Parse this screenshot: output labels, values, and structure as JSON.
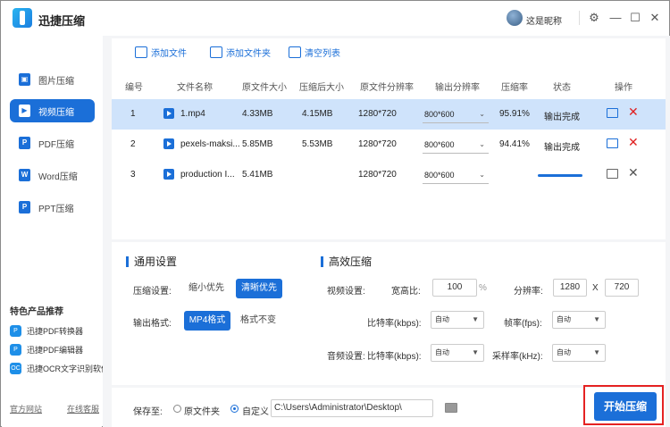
{
  "app": {
    "title": "迅捷压缩",
    "username": "这是昵称"
  },
  "window_controls": {
    "settings": "⚙",
    "minimize": "—",
    "maximize": "☐",
    "close": "✕"
  },
  "sidebar": {
    "items": [
      {
        "label": "图片压缩",
        "icon": "image-icon"
      },
      {
        "label": "视频压缩",
        "icon": "video-icon",
        "active": true
      },
      {
        "label": "PDF压缩",
        "icon": "pdf-icon"
      },
      {
        "label": "Word压缩",
        "icon": "word-icon"
      },
      {
        "label": "PPT压缩",
        "icon": "ppt-icon"
      }
    ],
    "featured_title": "特色产品推荐",
    "featured": [
      {
        "label": "迅捷PDF转换器"
      },
      {
        "label": "迅捷PDF编辑器"
      },
      {
        "label": "迅捷OCR文字识别软件"
      }
    ],
    "official_site": "官方网站",
    "online_service": "在线客服"
  },
  "toolbar": {
    "add_file": "添加文件",
    "add_folder": "添加文件夹",
    "clear_list": "清空列表"
  },
  "table": {
    "headers": [
      "编号",
      "文件名称",
      "原文件大小",
      "压缩后大小",
      "原文件分辨率",
      "输出分辨率",
      "压缩率",
      "状态",
      "操作"
    ],
    "rows": [
      {
        "no": "1",
        "name": "1.mp4",
        "orig_size": "4.33MB",
        "comp_size": "4.15MB",
        "orig_res": "1280*720",
        "out_res": "800*600",
        "rate": "95.91%",
        "status": "输出完成"
      },
      {
        "no": "2",
        "name": "pexels-maksi...",
        "orig_size": "5.85MB",
        "comp_size": "5.53MB",
        "orig_res": "1280*720",
        "out_res": "800*600",
        "rate": "94.41%",
        "status": "输出完成"
      },
      {
        "no": "3",
        "name": "production I...",
        "orig_size": "5.41MB",
        "comp_size": "",
        "orig_res": "1280*720",
        "out_res": "800*600",
        "rate": "",
        "status": ""
      }
    ]
  },
  "general": {
    "title": "通用设置",
    "compress_label": "压缩设置:",
    "compress_opts": [
      "缩小优先",
      "清晰优先"
    ],
    "format_label": "输出格式:",
    "format_opts": [
      "MP4格式",
      "格式不变"
    ]
  },
  "advanced": {
    "title": "高效压缩",
    "video_label": "视频设置:",
    "aspect_label": "宽高比:",
    "aspect_value": "100",
    "aspect_unit": "%",
    "res_label": "分辨率:",
    "res_w": "1280",
    "res_x": "X",
    "res_h": "720",
    "bitrate_label": "比特率(kbps):",
    "bitrate_value": "自动",
    "fps_label": "帧率(fps):",
    "fps_value": "自动",
    "audio_label": "音频设置:",
    "abitrate_label": "比特率(kbps):",
    "abitrate_value": "自动",
    "sample_label": "采样率(kHz):",
    "sample_value": "自动"
  },
  "save": {
    "label": "保存至:",
    "opt_source": "原文件夹",
    "opt_custom": "自定义",
    "path": "C:\\Users\\Administrator\\Desktop\\"
  },
  "start_button": "开始压缩",
  "progress_row3": 0.9
}
